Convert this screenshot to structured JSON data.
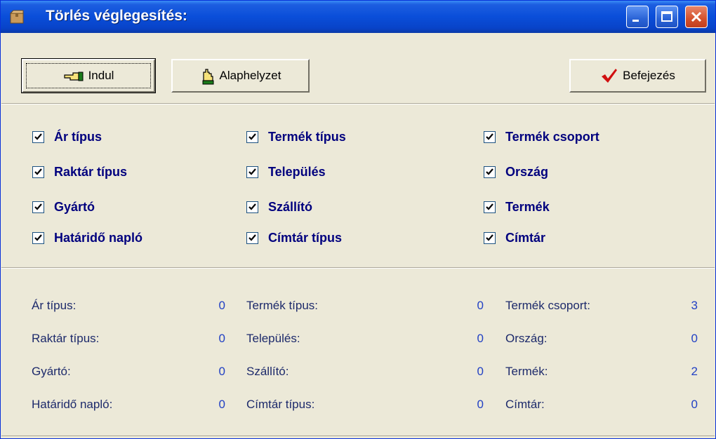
{
  "window": {
    "title": "Törlés véglegesítés:"
  },
  "toolbar": {
    "start_label": "Indul",
    "reset_label": "Alaphelyzet",
    "finish_label": "Befejezés"
  },
  "options": [
    {
      "label": "Ár típus",
      "checked": true
    },
    {
      "label": "Raktár típus",
      "checked": true
    },
    {
      "label": "Gyártó",
      "checked": true
    },
    {
      "label": "Határidő napló",
      "checked": true
    },
    {
      "label": "Termék típus",
      "checked": true
    },
    {
      "label": "Település",
      "checked": true
    },
    {
      "label": "Szállító",
      "checked": true
    },
    {
      "label": "Címtár típus",
      "checked": true
    },
    {
      "label": "Termék csoport",
      "checked": true
    },
    {
      "label": "Ország",
      "checked": true
    },
    {
      "label": "Termék",
      "checked": true
    },
    {
      "label": "Címtár",
      "checked": true
    }
  ],
  "counts": [
    {
      "label": "Ár típus:",
      "value": "0"
    },
    {
      "label": "Raktár típus:",
      "value": "0"
    },
    {
      "label": "Gyártó:",
      "value": "0"
    },
    {
      "label": "Határidő napló:",
      "value": "0"
    },
    {
      "label": "Termék típus:",
      "value": "0"
    },
    {
      "label": "Település:",
      "value": "0"
    },
    {
      "label": "Szállító:",
      "value": "0"
    },
    {
      "label": "Címtár típus:",
      "value": "0"
    },
    {
      "label": "Termék csoport:",
      "value": "3"
    },
    {
      "label": "Ország:",
      "value": "0"
    },
    {
      "label": "Termék:",
      "value": "2"
    },
    {
      "label": "Címtár:",
      "value": "0"
    }
  ],
  "colors": {
    "checkbox_text": "#00007e",
    "count_value": "#2241c4",
    "titlebar": "#0a4ed9"
  }
}
